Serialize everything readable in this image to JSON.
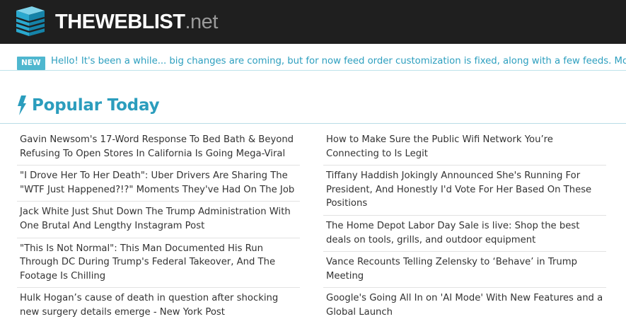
{
  "header": {
    "logo_main": "THEWEBLIST",
    "logo_suffix": ".net",
    "icon": "server-stack-icon",
    "bg_color": "#1f1f1f"
  },
  "announcement": {
    "badge": "NEW",
    "text": "Hello! It's been a while... big changes are coming, but for now feed order customization is fixed, along with a few feeds. More soon!",
    "accent": "#2d9fbf"
  },
  "section": {
    "icon": "lightning-bolt-icon",
    "title": "Popular Today",
    "accent": "#2b9dbd"
  },
  "left_column": [
    "Gavin Newsom's 17-Word Response To Bed Bath & Beyond Refusing To Open Stores In California Is Going Mega-Viral",
    "\"I Drove Her To Her Death\": Uber Drivers Are Sharing The \"WTF Just Happened?!?\" Moments They've Had On The Job",
    "Jack White Just Shut Down The Trump Administration With One Brutal And Lengthy Instagram Post",
    "\"This Is Not Normal\": This Man Documented His Run Through DC During Trump's Federal Takeover, And The Footage Is Chilling",
    "Hulk Hogan’s cause of death in question after shocking new surgery details emerge - New York Post"
  ],
  "right_column": [
    "How to Make Sure the Public Wifi Network You’re Connecting to Is Legit",
    "Tiffany Haddish Jokingly Announced She's Running For President, And Honestly I'd Vote For Her Based On These Positions",
    "The Home Depot Labor Day Sale is live: Shop the best deals on tools, grills, and outdoor equipment",
    "Vance Recounts Telling Zelensky to ‘Behave’ in Trump Meeting",
    "Google's Going All In on 'AI Mode' With New Features and a Global Launch"
  ]
}
